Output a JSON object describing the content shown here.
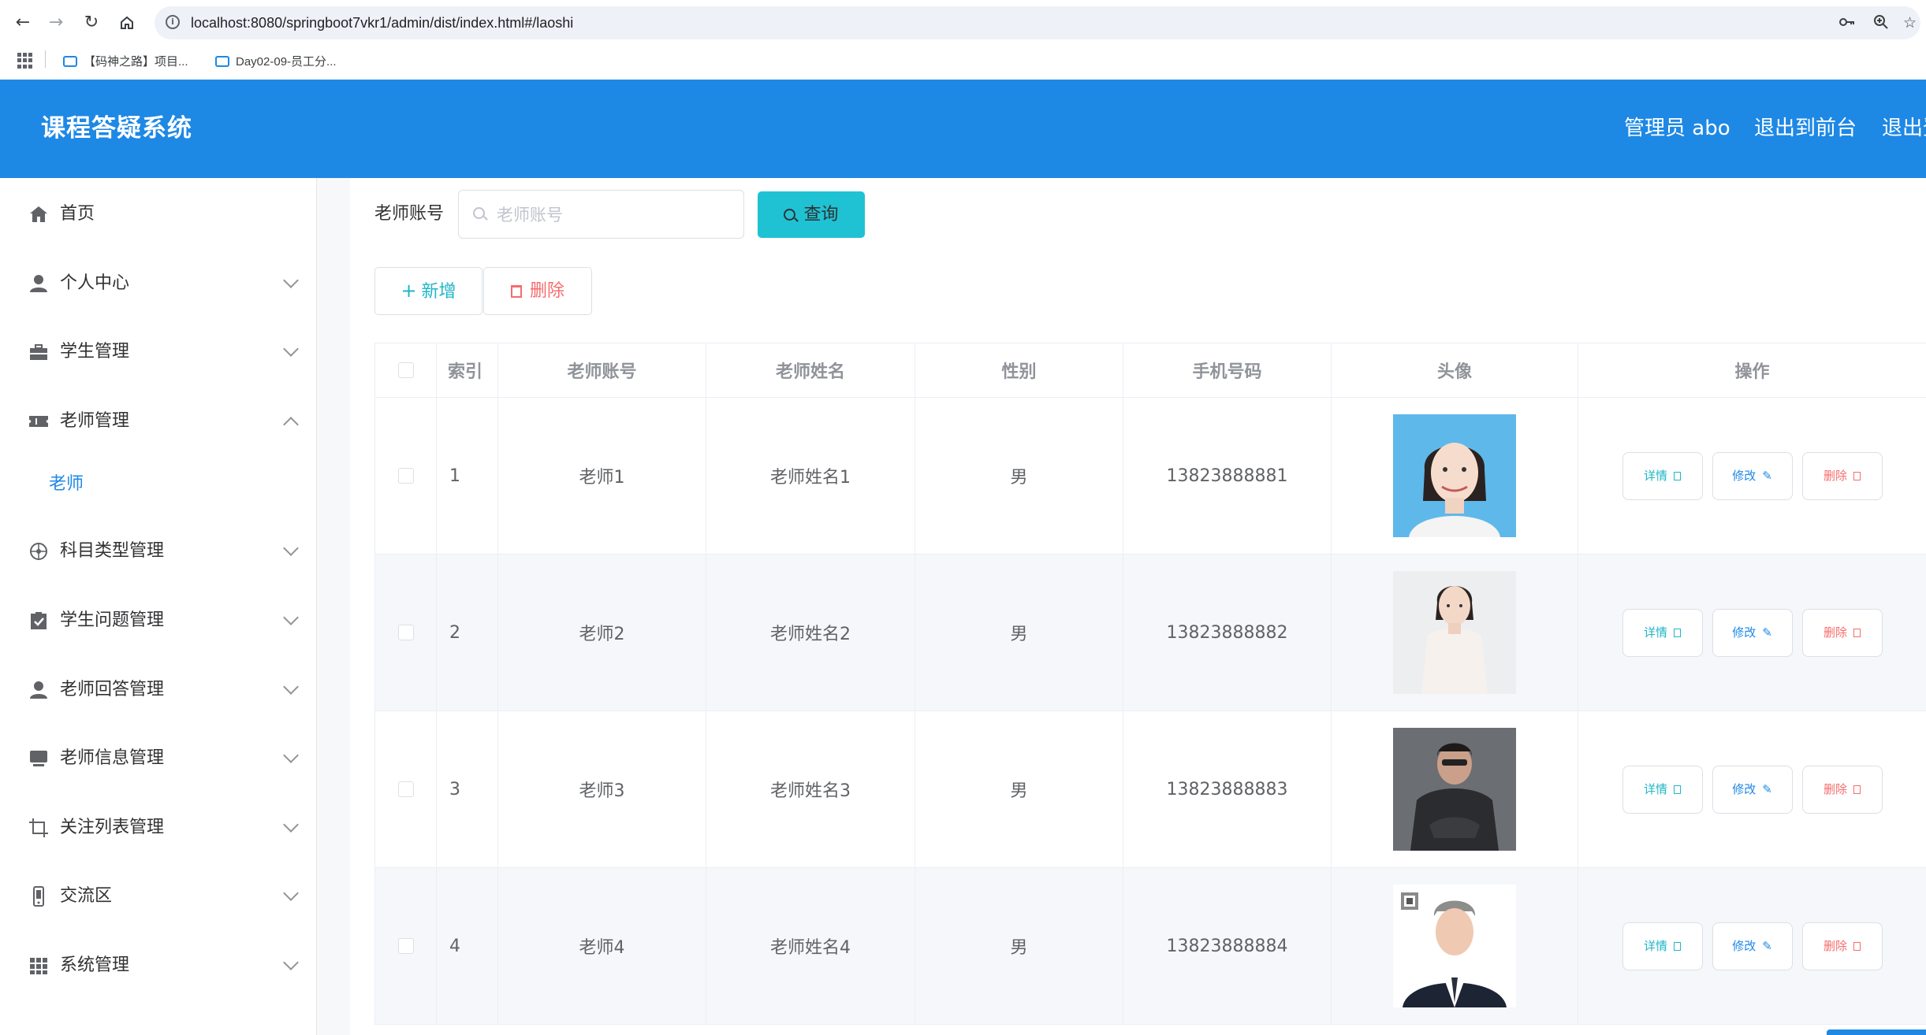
{
  "browser": {
    "url": "localhost:8080/springboot7vkr1/admin/dist/index.html#/laoshi",
    "bookmarks": [
      {
        "label": "【码神之路】项目..."
      },
      {
        "label": "Day02-09-员工分..."
      }
    ]
  },
  "header": {
    "title": "课程答疑系统",
    "admin_label": "管理员 abo",
    "front_label": "退出到前台",
    "logout_label": "退出登录"
  },
  "sidebar": {
    "items": [
      {
        "label": "首页",
        "icon": "home-icon"
      },
      {
        "label": "个人中心",
        "icon": "user-icon"
      },
      {
        "label": "学生管理",
        "icon": "briefcase-icon"
      },
      {
        "label": "老师管理",
        "icon": "ticket-icon"
      },
      {
        "label": "科目类型管理",
        "icon": "compass-icon"
      },
      {
        "label": "学生问题管理",
        "icon": "clipboard-check-icon"
      },
      {
        "label": "老师回答管理",
        "icon": "user-icon"
      },
      {
        "label": "老师信息管理",
        "icon": "monitor-icon"
      },
      {
        "label": "关注列表管理",
        "icon": "crop-icon"
      },
      {
        "label": "交流区",
        "icon": "phone-icon"
      },
      {
        "label": "系统管理",
        "icon": "grid-icon"
      }
    ],
    "sub_item": "老师"
  },
  "search": {
    "label": "老师账号",
    "placeholder": "老师账号",
    "value": "",
    "button": "查询"
  },
  "actions": {
    "add": "新增",
    "delete": "删除"
  },
  "table": {
    "headers": [
      "索引",
      "老师账号",
      "老师姓名",
      "性别",
      "手机号码",
      "头像",
      "操作"
    ],
    "op_labels": {
      "detail": "详情",
      "edit": "修改",
      "remove": "删除"
    },
    "rows": [
      {
        "index": "1",
        "account": "老师1",
        "name": "老师姓名1",
        "gender": "男",
        "phone": "13823888881"
      },
      {
        "index": "2",
        "account": "老师2",
        "name": "老师姓名2",
        "gender": "男",
        "phone": "13823888882"
      },
      {
        "index": "3",
        "account": "老师3",
        "name": "老师姓名3",
        "gender": "男",
        "phone": "13823888883"
      },
      {
        "index": "4",
        "account": "老师4",
        "name": "老师姓名4",
        "gender": "男",
        "phone": "13823888884"
      }
    ]
  },
  "colors": {
    "primary": "#1e88e5",
    "query": "#1fc2d3",
    "danger": "#f56c6c"
  }
}
